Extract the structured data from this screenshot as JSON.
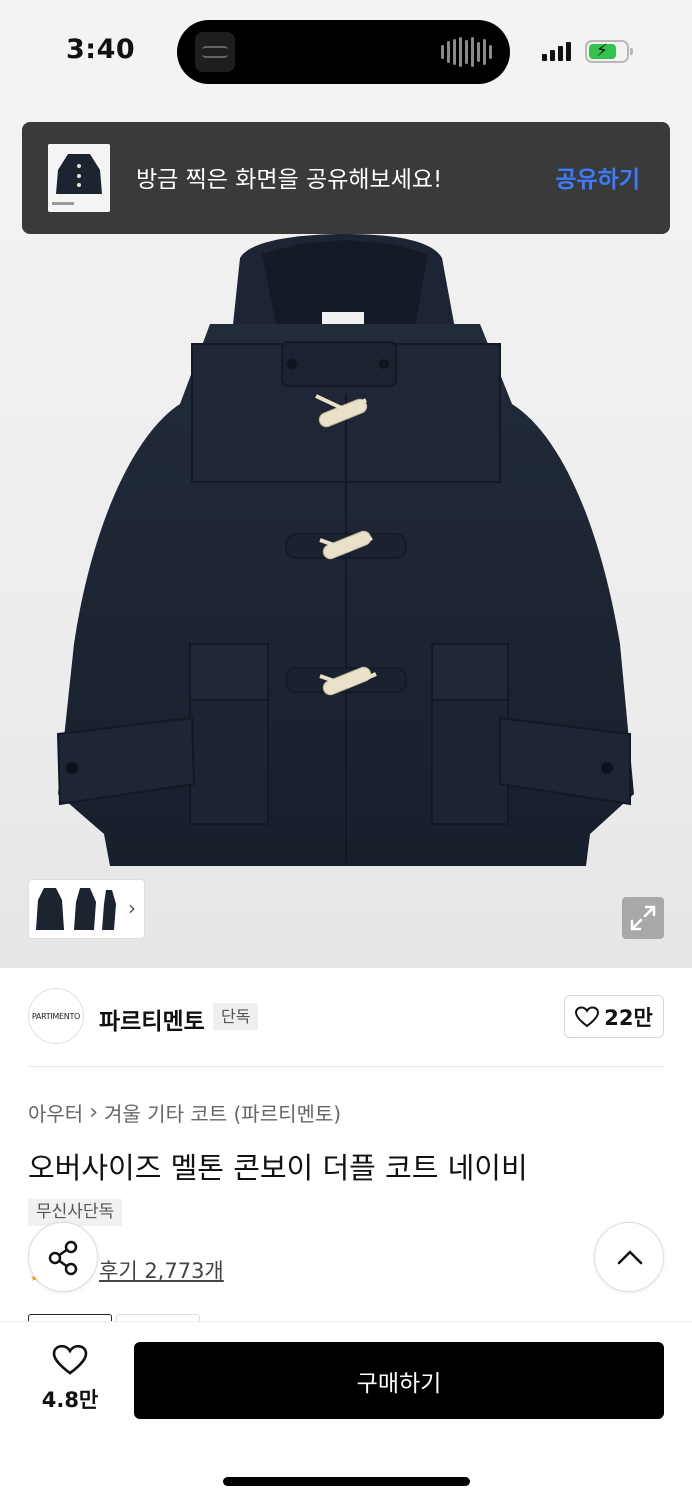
{
  "status": {
    "time": "3:40"
  },
  "toast": {
    "message": "방금 찍은 화면을 공유해보세요!",
    "action": "공유하기"
  },
  "brand": {
    "logo_text": "PARTIMENTO",
    "name": "파르티멘토",
    "badge": "단독",
    "likes": "22만"
  },
  "breadcrumb": {
    "category": "아우터",
    "subcategory": "겨울 기타 코트 (파르티멘토)"
  },
  "product": {
    "title": "오버사이즈 멜톤 콘보이 더플 코트 네이비",
    "tag": "무신사단독",
    "reviews": "후기 2,773개"
  },
  "bottom": {
    "wish_count": "4.8만",
    "buy_label": "구매하기"
  },
  "colors": {
    "accent": "#3c7bff",
    "coat": "#1c2331",
    "toggle": "#e9e1c8"
  }
}
